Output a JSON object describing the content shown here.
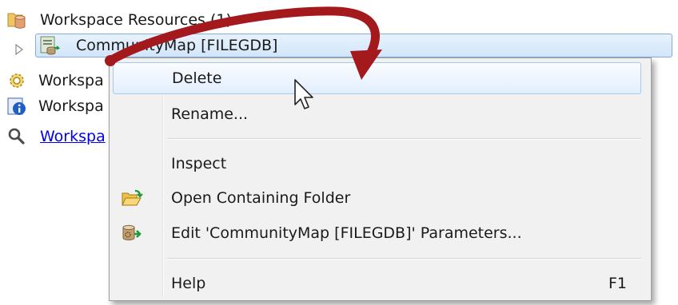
{
  "tree": {
    "items": [
      {
        "label": "Workspace Resources (1)",
        "icon": "database-folder-icon"
      },
      {
        "label": "CommunityMap [FILEGDB]",
        "icon": "filegdb-reader-icon",
        "selected": true,
        "expander": "collapsed"
      },
      {
        "label": "Workspa",
        "icon": "gear-parameters-icon"
      },
      {
        "label": "Workspa",
        "icon": "info-icon"
      },
      {
        "label": "Workspa",
        "icon": "search-icon",
        "link": true
      }
    ]
  },
  "context_menu": {
    "items": [
      {
        "label": "Delete",
        "highlighted": true
      },
      {
        "label": "Rename..."
      },
      {
        "label": "Inspect"
      },
      {
        "label": "Open Containing Folder",
        "icon": "open-folder-icon"
      },
      {
        "label": "Edit 'CommunityMap [FILEGDB]' Parameters...",
        "icon": "edit-database-parameters-icon"
      },
      {
        "label": "Help",
        "accelerator": "F1"
      }
    ]
  },
  "colors": {
    "selection": "#d2e6fb",
    "arrow": "#a3191c",
    "link": "#0000ee",
    "menu_background": "#f1f1f1"
  }
}
